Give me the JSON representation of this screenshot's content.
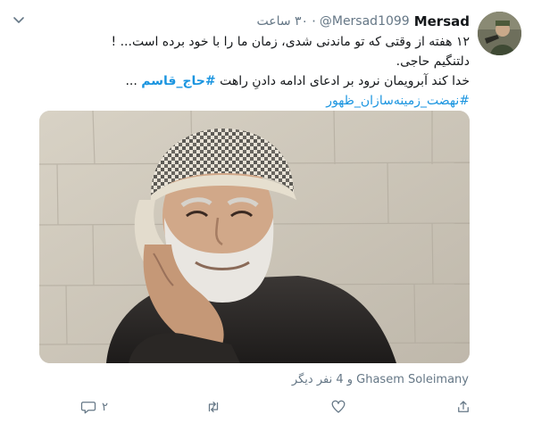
{
  "tweet": {
    "author_name": "Mersad",
    "handle": "@Mersad1099",
    "separator": "·",
    "time": "۳۰ ساعت",
    "lines": [
      "۱۲ هفته از وقتی که تو ماندنی شدی، زمان ما را با خود برده است... !",
      "دلتنگیم حاجی."
    ],
    "line3_prefix": "خدا کند آبرویمان نرود بر ادعای ادامه دادنِ راهت ",
    "line3_hashtag": "#حاج_قاسم",
    "line3_suffix": " ...",
    "hashtag_line": "#نهضت_زمینه‌سازان_ظهور",
    "image_alt": "photo",
    "likers_text": "Ghasem Soleimany و 4 نفر دیگر",
    "actions": {
      "reply_count": "۲",
      "retweet_count": "",
      "like_count": "",
      "share_count": ""
    }
  },
  "icons": {
    "chevron": "chevron-down-icon",
    "reply": "reply-icon",
    "retweet": "retweet-icon",
    "like": "heart-icon",
    "share": "share-icon"
  },
  "colors": {
    "link": "#1b95e0",
    "secondary": "#657786",
    "text": "#14171a"
  }
}
